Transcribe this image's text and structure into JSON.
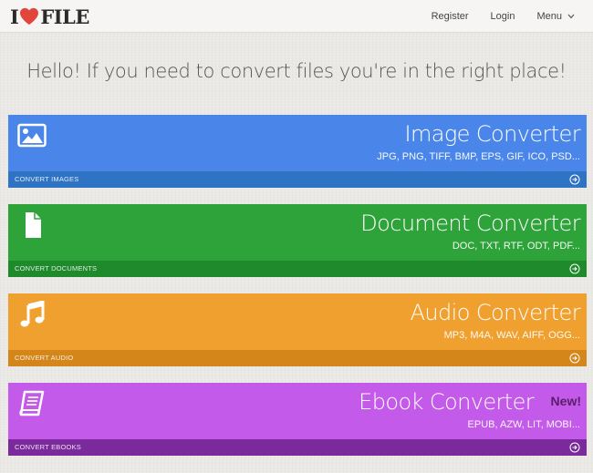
{
  "header": {
    "logo": {
      "prefix": "I",
      "heart_icon": "heart-icon",
      "suffix": "FILE"
    },
    "nav": {
      "register": "Register",
      "login": "Login",
      "menu": "Menu",
      "menu_icon": "chevron-down-icon"
    }
  },
  "headline": "Hello! If you need to convert files you're in the right place!",
  "converters": [
    {
      "title": "Image Converter",
      "formats": "JPG, PNG, TIFF, BMP, EPS, GIF, ICO, PSD...",
      "footer": "CONVERT IMAGES",
      "icon": "image-icon",
      "color": "#4a86ea"
    },
    {
      "title": "Document Converter",
      "formats": "DOC, TXT, RTF, ODT, PDF...",
      "footer": "CONVERT DOCUMENTS",
      "icon": "document-icon",
      "color": "#2ea33a"
    },
    {
      "title": "Audio Converter",
      "formats": "MP3, M4A, WAV, AIFF, OGG...",
      "footer": "CONVERT AUDIO",
      "icon": "music-note-icon",
      "color": "#f0a02e"
    },
    {
      "title": "Ebook Converter",
      "formats": "EPUB, AZW, LIT, MOBI...",
      "footer": "CONVERT EBOOKS",
      "icon": "book-icon",
      "badge": "New!",
      "color": "#c45ae9"
    }
  ]
}
